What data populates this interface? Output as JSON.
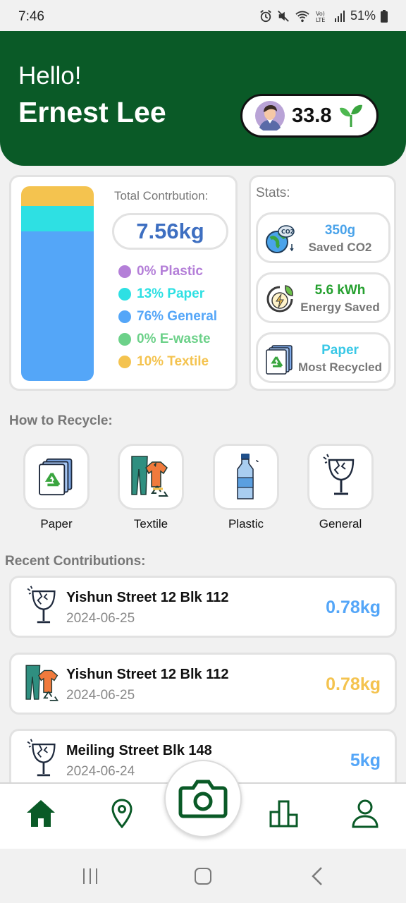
{
  "status_bar": {
    "time": "7:46",
    "battery": "51%",
    "icons": [
      "alarm-icon",
      "mute-icon",
      "wifi-icon",
      "volte-icon",
      "signal-icon",
      "battery-icon"
    ]
  },
  "header": {
    "greeting": "Hello!",
    "user_name": "Ernest Lee",
    "points": "33.8",
    "avatar_icon": "avatar-icon",
    "points_icon": "sprout-icon"
  },
  "contribution": {
    "title": "Total Contrbution:",
    "total": "7.56kg",
    "breakdown": [
      {
        "label": "0% Plastic",
        "percent": 0,
        "color": "#b47fd8"
      },
      {
        "label": "13% Paper",
        "percent": 13,
        "color": "#2ee0e3"
      },
      {
        "label": "76% General",
        "percent": 76,
        "color": "#54a6f8"
      },
      {
        "label": "0% E-waste",
        "percent": 0,
        "color": "#6cd189"
      },
      {
        "label": "10% Textile",
        "percent": 10,
        "color": "#f4c34f"
      }
    ]
  },
  "stats": {
    "title": "Stats:",
    "items": [
      {
        "value": "350g",
        "label": "Saved CO2",
        "color": "#4aa3ea",
        "icon": "earth-co2-icon"
      },
      {
        "value": "5.6 kWh",
        "label": "Energy Saved",
        "color": "#25a02f",
        "icon": "energy-icon"
      },
      {
        "value": "Paper",
        "label": "Most Recycled",
        "color": "#39c8e6",
        "icon": "paper-recycle-icon"
      }
    ]
  },
  "how_to": {
    "title": "How to Recycle:",
    "items": [
      {
        "label": "Paper",
        "icon": "paper-recycle-icon"
      },
      {
        "label": "Textile",
        "icon": "textile-icon"
      },
      {
        "label": "Plastic",
        "icon": "plastic-bottle-icon"
      },
      {
        "label": "General",
        "icon": "broken-glass-icon"
      }
    ]
  },
  "recent": {
    "title": "Recent Contributions:",
    "items": [
      {
        "place": "Yishun Street 12 Blk 112",
        "date": "2024-06-25",
        "weight": "0.78kg",
        "color": "#54a6f8",
        "icon": "broken-glass-icon"
      },
      {
        "place": "Yishun Street 12 Blk 112",
        "date": "2024-06-25",
        "weight": "0.78kg",
        "color": "#f4c34f",
        "icon": "textile-icon"
      },
      {
        "place": "Meiling Street Blk 148",
        "date": "2024-06-24",
        "weight": "5kg",
        "color": "#54a6f8",
        "icon": "broken-glass-icon"
      }
    ]
  },
  "nav": {
    "items": [
      "home-icon",
      "location-icon",
      "camera-icon",
      "leaderboard-icon",
      "profile-icon"
    ],
    "active": "home-icon",
    "accent": "#0a5a27"
  }
}
